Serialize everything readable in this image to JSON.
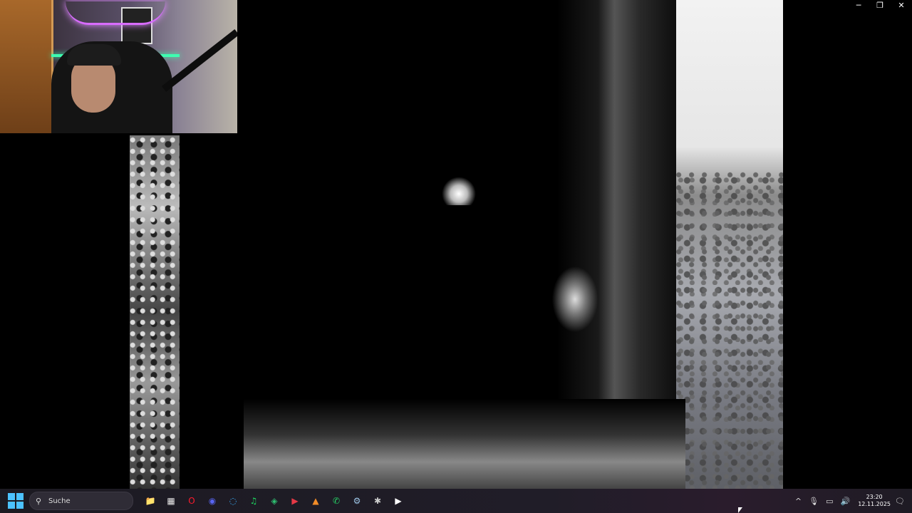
{
  "window": {
    "minimize": "─",
    "restore": "❐",
    "close": "✕"
  },
  "taskbar": {
    "search_placeholder": "Suche",
    "apps": [
      {
        "name": "file-explorer-icon",
        "glyph": "📁",
        "color": "#f6c343"
      },
      {
        "name": "store-icon",
        "glyph": "▦",
        "color": "#e8e8e8"
      },
      {
        "name": "opera-icon",
        "glyph": "O",
        "color": "#ff1b2d"
      },
      {
        "name": "discord-icon",
        "glyph": "◉",
        "color": "#5865f2"
      },
      {
        "name": "browser-icon",
        "glyph": "◌",
        "color": "#3ab0ff"
      },
      {
        "name": "spotify-icon",
        "glyph": "♫",
        "color": "#1ed760"
      },
      {
        "name": "app-green-icon",
        "glyph": "◈",
        "color": "#2fbf71"
      },
      {
        "name": "app-red-icon",
        "glyph": "▶",
        "color": "#e63946"
      },
      {
        "name": "app-orange-icon",
        "glyph": "▲",
        "color": "#f28c28"
      },
      {
        "name": "whatsapp-icon",
        "glyph": "✆",
        "color": "#25d366"
      },
      {
        "name": "steam-icon",
        "glyph": "⚙",
        "color": "#9ec7e8"
      },
      {
        "name": "app-settings-icon",
        "glyph": "✱",
        "color": "#cccccc"
      },
      {
        "name": "media-player-icon",
        "glyph": "▶",
        "color": "#ffffff"
      }
    ],
    "tray": {
      "chevron": "^",
      "mic": "🎙",
      "network": "▭",
      "volume": "🔊",
      "notification": "🗨"
    },
    "clock": {
      "time": "23:20",
      "date": "12.11.2025"
    }
  }
}
